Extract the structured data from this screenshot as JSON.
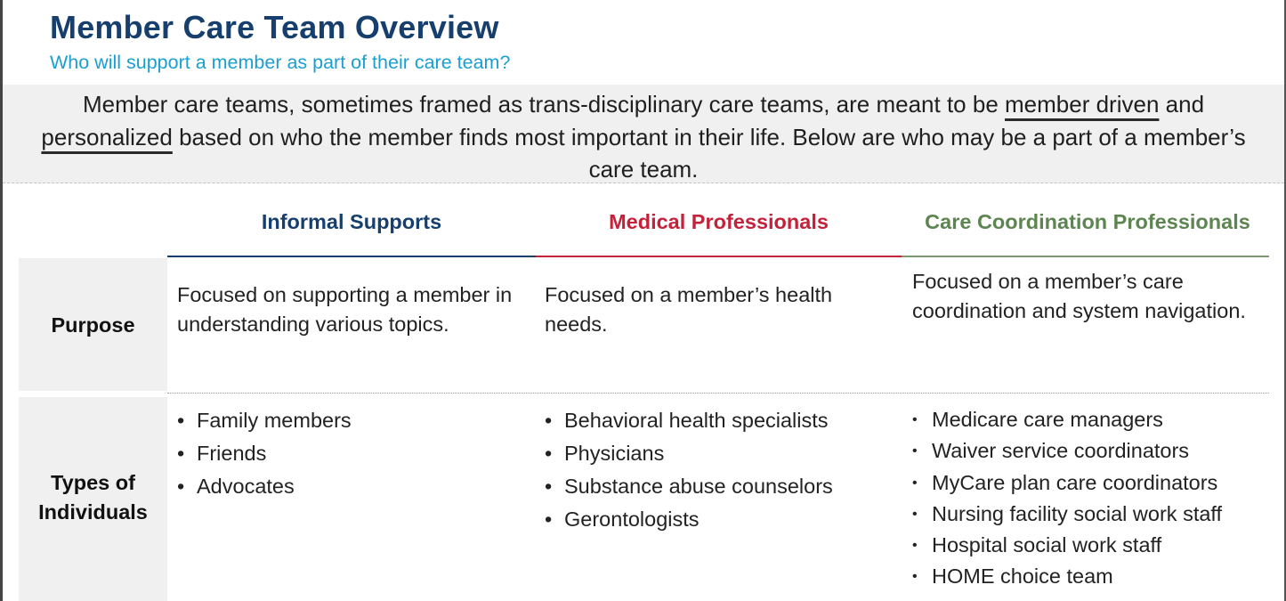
{
  "header": {
    "title": "Member Care Team Overview",
    "subtitle": "Who will support a member as part of their care team?"
  },
  "intro": {
    "part1": "Member care teams, sometimes framed as trans-disciplinary care teams, are meant to be ",
    "underline1": "member driven",
    "part2": " and ",
    "underline2": "personalized",
    "part3": " based on who the member finds most important in their life. Below are who may be a part of a member’s care team."
  },
  "columns": [
    {
      "label": "Informal Supports",
      "color": "#173f6e"
    },
    {
      "label": "Medical Professionals",
      "color": "#c3223a"
    },
    {
      "label": "Care Coordination Professionals",
      "color": "#5d8550"
    }
  ],
  "rows": {
    "purpose": {
      "label": "Purpose",
      "cells": [
        "Focused on supporting a member in understanding various topics.",
        "Focused on a member’s health needs.",
        "Focused on a member’s care coordination and system navigation."
      ]
    },
    "types": {
      "label_line1": "Types of",
      "label_line2": "Individuals",
      "bullet": "•",
      "cells": [
        [
          "Family members",
          "Friends",
          "Advocates"
        ],
        [
          "Behavioral health specialists",
          "Physicians",
          "Substance abuse counselors",
          "Gerontologists"
        ],
        [
          "Medicare care managers",
          "Waiver service coordinators",
          "MyCare plan care coordinators",
          "Nursing facility social work staff",
          "Hospital social work staff",
          "HOME choice team"
        ]
      ]
    }
  }
}
